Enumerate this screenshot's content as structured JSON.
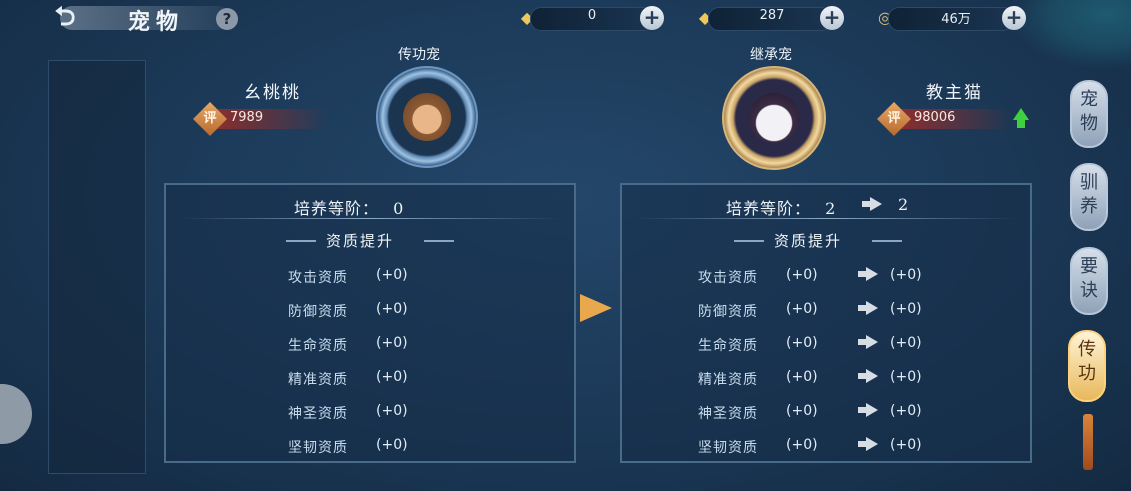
{
  "header": {
    "title": "宠物",
    "help_label": "?",
    "back_label": "⮌"
  },
  "resources": [
    {
      "icon": "gold-ingot-icon",
      "glyph": "◆",
      "value": "0",
      "plus": "+"
    },
    {
      "icon": "gold-ingot-icon",
      "glyph": "◆",
      "value": "287",
      "plus": "+"
    },
    {
      "icon": "copper-coin-icon",
      "glyph": "◎",
      "value": "46万",
      "plus": "+"
    }
  ],
  "source_pet": {
    "role": "传功宠",
    "name": "幺桃桃",
    "score_char": "评",
    "score": "7989"
  },
  "target_pet": {
    "role": "继承宠",
    "name": "教主猫",
    "score_char": "评",
    "score": "98006"
  },
  "left_panel": {
    "level_text": "培养等阶：",
    "level": "0",
    "section_title": "资质提升",
    "stats": [
      {
        "label": "攻击资质",
        "value": "(+0)"
      },
      {
        "label": "防御资质",
        "value": "(+0)"
      },
      {
        "label": "生命资质",
        "value": "(+0)"
      },
      {
        "label": "精准资质",
        "value": "(+0)"
      },
      {
        "label": "神圣资质",
        "value": "(+0)"
      },
      {
        "label": "坚韧资质",
        "value": "(+0)"
      }
    ]
  },
  "right_panel": {
    "level_text": "培养等阶：",
    "level_from": "2",
    "level_to": "2",
    "section_title": "资质提升",
    "stats": [
      {
        "label": "攻击资质",
        "from": "(+0)",
        "to": "(+0)"
      },
      {
        "label": "防御资质",
        "from": "(+0)",
        "to": "(+0)"
      },
      {
        "label": "生命资质",
        "from": "(+0)",
        "to": "(+0)"
      },
      {
        "label": "精准资质",
        "from": "(+0)",
        "to": "(+0)"
      },
      {
        "label": "神圣资质",
        "from": "(+0)",
        "to": "(+0)"
      },
      {
        "label": "坚韧资质",
        "from": "(+0)",
        "to": "(+0)"
      }
    ]
  },
  "side_tabs": [
    {
      "label": "宠物",
      "active": false
    },
    {
      "label": "驯养",
      "active": false
    },
    {
      "label": "要诀",
      "active": false
    },
    {
      "label": "传功",
      "active": true
    }
  ],
  "colors": {
    "background": "#1b3856",
    "score_bar": "#8a2e2e",
    "transfer_arrow": "#e9a84e",
    "upgrade_arrow": "#3fcf3f",
    "active_tab": "#e8b85c"
  }
}
